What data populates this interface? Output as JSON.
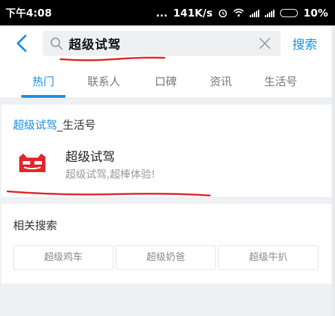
{
  "status_bar": {
    "time": "下午4:08",
    "dots": "...",
    "speed": "141K/s",
    "battery": "10%"
  },
  "search": {
    "query": "超级试驾",
    "submit_label": "搜索"
  },
  "tabs": [
    {
      "label": "热门",
      "active": true
    },
    {
      "label": "联系人",
      "active": false
    },
    {
      "label": "口碑",
      "active": false
    },
    {
      "label": "资讯",
      "active": false
    },
    {
      "label": "生活号",
      "active": false
    }
  ],
  "result_section": {
    "keyword": "超级试驾",
    "suffix": "_生活号",
    "item": {
      "name": "超级试驾",
      "description": "超级试驾,超棒体验!",
      "logo_icon": "tmall-cat-logo"
    }
  },
  "related": {
    "title": "相关搜索",
    "items": [
      "超级鸡车",
      "超级奶爸",
      "超级牛扒"
    ]
  },
  "colors": {
    "accent": "#1a8fe3",
    "annotation": "#e02020",
    "logo_red": "#e0262b"
  }
}
